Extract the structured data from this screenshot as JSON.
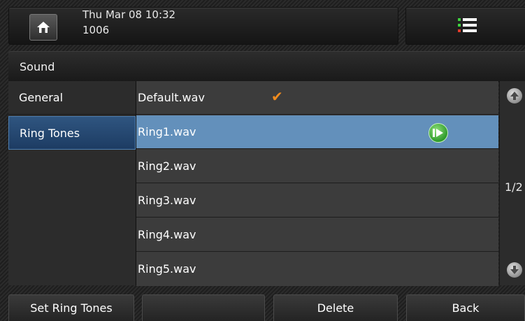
{
  "status": {
    "date_time": "Thu Mar 08 10:32",
    "account": "1006"
  },
  "title": "Sound",
  "sidebar": {
    "items": [
      {
        "label": "General",
        "active": false
      },
      {
        "label": "Ring Tones",
        "active": true
      }
    ]
  },
  "ringtones": {
    "items": [
      {
        "label": "Default.wav",
        "checked": true,
        "selected": false
      },
      {
        "label": "Ring1.wav",
        "checked": false,
        "selected": true
      },
      {
        "label": "Ring2.wav",
        "checked": false,
        "selected": false
      },
      {
        "label": "Ring3.wav",
        "checked": false,
        "selected": false
      },
      {
        "label": "Ring4.wav",
        "checked": false,
        "selected": false
      },
      {
        "label": "Ring5.wav",
        "checked": false,
        "selected": false
      }
    ]
  },
  "pager": {
    "indicator": "1/2"
  },
  "softkeys": {
    "key1": "Set Ring Tones",
    "key2": "",
    "key3": "Delete",
    "key4": "Back"
  },
  "icons": {
    "home": "home-icon",
    "menu": "menu-list-icon",
    "check": "checkmark-icon",
    "play": "play-icon",
    "up": "arrow-up-icon",
    "down": "arrow-down-icon"
  },
  "colors": {
    "selection": "#6390bb",
    "check": "#f08b1e",
    "play": "#2e9a2a"
  }
}
